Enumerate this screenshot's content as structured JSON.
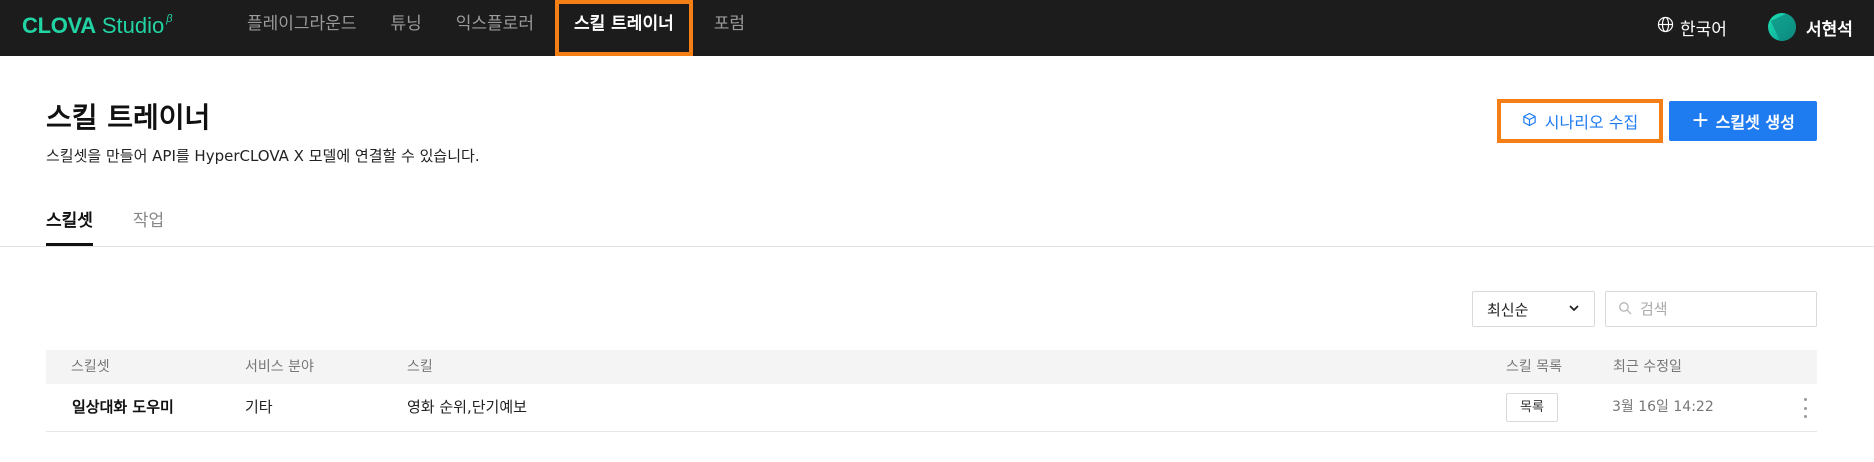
{
  "topbar": {
    "logo": {
      "main": "CLOVA",
      "sub": "Studio",
      "beta": "β"
    },
    "nav": [
      {
        "label": "플레이그라운드",
        "active": false
      },
      {
        "label": "튜닝",
        "active": false
      },
      {
        "label": "익스플로러",
        "active": false
      },
      {
        "label": "스킬 트레이너",
        "active": true
      },
      {
        "label": "포럼",
        "active": false
      }
    ],
    "language": {
      "icon": "globe-icon",
      "label": "한국어"
    },
    "user": {
      "name": "서현석"
    }
  },
  "header": {
    "title": "스킬 트레이너",
    "description": "스킬셋을 만들어 API를 HyperCLOVA X 모델에 연결할 수 있습니다.",
    "scenario_button": {
      "icon": "cube-icon",
      "label": "시나리오 수집"
    },
    "create_button": {
      "icon": "plus-icon",
      "label": "스킬셋 생성"
    }
  },
  "tabs": [
    {
      "label": "스킬셋",
      "active": true
    },
    {
      "label": "작업",
      "active": false
    }
  ],
  "filters": {
    "sort": {
      "selected": "최신순",
      "icon": "chevron-down-icon"
    },
    "search": {
      "placeholder": "검색",
      "value": "",
      "icon": "search-icon"
    }
  },
  "table": {
    "columns": [
      "스킬셋",
      "서비스 분야",
      "스킬",
      "스킬 목록",
      "최근 수정일"
    ],
    "rows": [
      {
        "skillset": "일상대화 도우미",
        "service": "기타",
        "skills": "영화 순위,단기예보",
        "list_button": "목록",
        "modified": "3월 16일 14:22"
      }
    ]
  },
  "colors": {
    "topbar_bg": "#1c1c1c",
    "brand": "#22d3a3",
    "accent_blue": "#1f7bf0",
    "highlight_orange": "#f57f17"
  }
}
